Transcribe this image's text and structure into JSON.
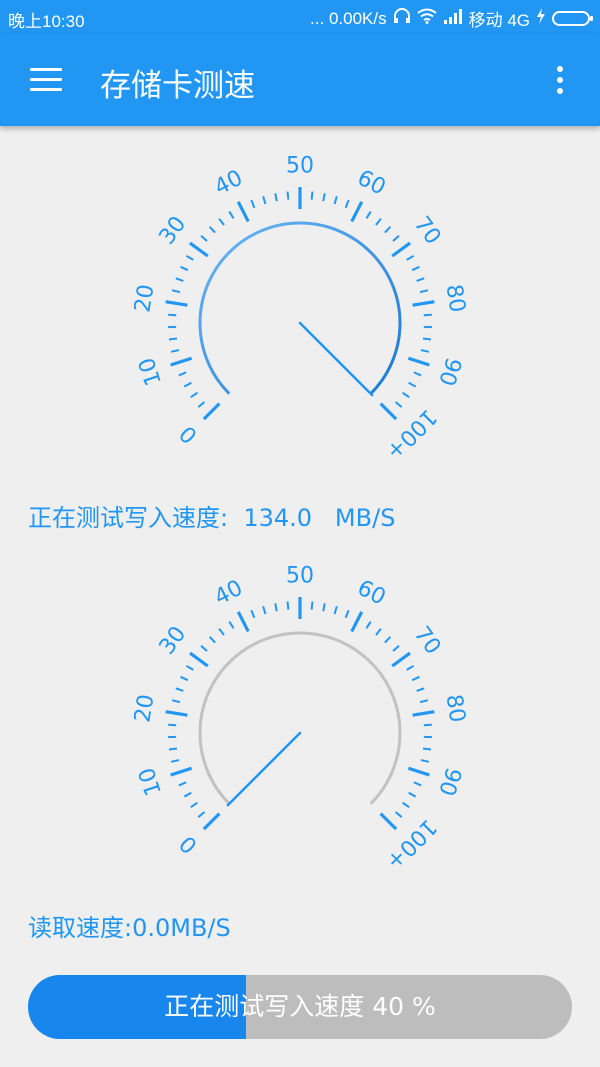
{
  "status_bar": {
    "time": "晚上10:30",
    "network_speed": "... 0.00K/s",
    "carrier": "移动 4G"
  },
  "app_bar": {
    "title": "存储卡测速",
    "menu_icon": "hamburger-menu-icon",
    "more_icon": "more-vert-icon"
  },
  "gauge_scale_labels": [
    "0",
    "10",
    "20",
    "30",
    "40",
    "50",
    "60",
    "70",
    "80",
    "90",
    "100+"
  ],
  "colors": {
    "primary": "#2196F3",
    "write_arc_start": "#6cb8f6",
    "write_arc_end": "#1b78d3",
    "read_arc": "#c2c2c2",
    "progress_fill": "#1787EE",
    "progress_track": "#bdbdbd"
  },
  "write_gauge": {
    "needle_value": 100,
    "arc_fill": 1.0
  },
  "read_gauge": {
    "needle_value": 0,
    "arc_fill": 0.0
  },
  "write_speed_text": "正在测试写入速度:  134.0   MB/S",
  "read_speed_text": "读取速度:0.0MB/S",
  "progress": {
    "label": "正在测试写入速度 40 %",
    "percent": 40
  }
}
